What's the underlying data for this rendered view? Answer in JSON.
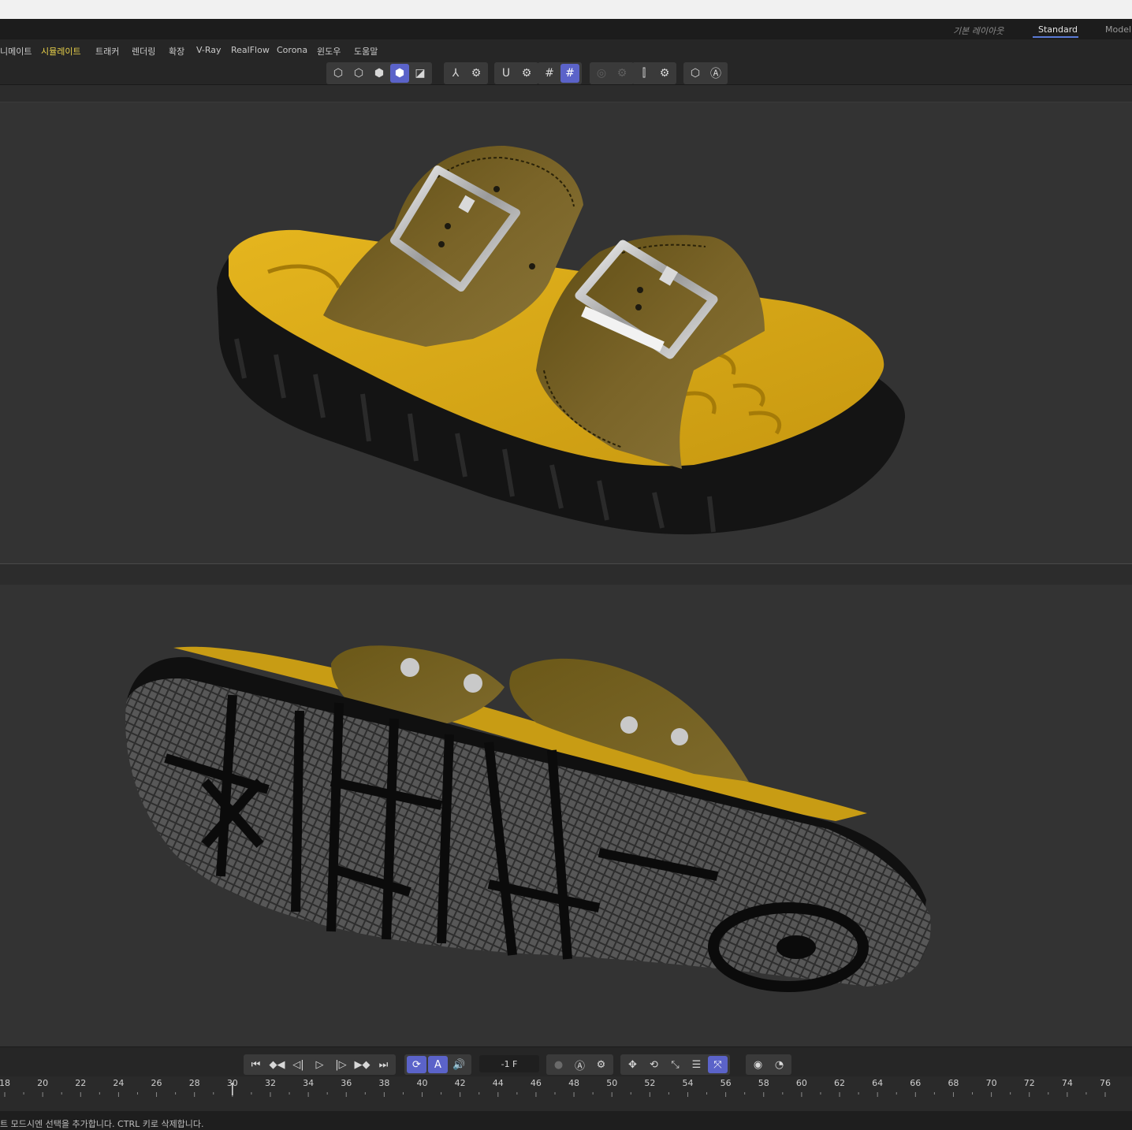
{
  "layouts": {
    "items": [
      {
        "label": "기본 레이아웃",
        "state": "italic"
      },
      {
        "label": "Standard",
        "state": "active"
      },
      {
        "label": "Model",
        "state": "normal"
      }
    ]
  },
  "menu": {
    "items": [
      {
        "label": "니메이트",
        "highlight": false
      },
      {
        "label": "시뮬레이트",
        "highlight": true
      },
      {
        "label": "트래커",
        "highlight": false
      },
      {
        "label": "렌더링",
        "highlight": false
      },
      {
        "label": "확장",
        "highlight": false
      },
      {
        "label": "V-Ray",
        "highlight": false
      },
      {
        "label": "RealFlow",
        "highlight": false
      },
      {
        "label": "Corona",
        "highlight": false
      },
      {
        "label": "윈도우",
        "highlight": false
      },
      {
        "label": "도움말",
        "highlight": false
      }
    ]
  },
  "toolbar": {
    "groups": [
      {
        "name": "mode-group",
        "buttons": [
          {
            "icon": "points-mode-icon",
            "glyph": "⬡",
            "active": false
          },
          {
            "icon": "edges-mode-icon",
            "glyph": "⬡",
            "active": false
          },
          {
            "icon": "polygons-mode-icon",
            "glyph": "⬢",
            "active": false
          },
          {
            "icon": "model-mode-icon",
            "glyph": "⬢",
            "active": true
          },
          {
            "icon": "texture-mode-icon",
            "glyph": "◪",
            "active": false
          }
        ]
      },
      {
        "name": "axis-group",
        "buttons": [
          {
            "icon": "axis-icon",
            "glyph": "⅄",
            "active": false
          },
          {
            "icon": "axis-settings-gear-icon",
            "glyph": "⚙",
            "active": false
          }
        ]
      },
      {
        "name": "snap-group",
        "buttons": [
          {
            "icon": "magnet-snap-icon",
            "glyph": "Ս",
            "active": false
          },
          {
            "icon": "snap-settings-gear-icon",
            "glyph": "⚙",
            "active": false
          }
        ]
      },
      {
        "name": "grid-group",
        "buttons": [
          {
            "icon": "grid-icon",
            "glyph": "#",
            "active": false
          },
          {
            "icon": "workplane-grid-icon",
            "glyph": "#",
            "active": true
          }
        ]
      },
      {
        "name": "softsel-group",
        "buttons": [
          {
            "icon": "soft-selection-icon",
            "glyph": "◎",
            "active": false,
            "dim": true
          },
          {
            "icon": "soft-selection-gear-icon",
            "glyph": "⚙",
            "active": false,
            "dim": true
          }
        ]
      },
      {
        "name": "symmetry-group",
        "buttons": [
          {
            "icon": "symmetry-icon",
            "glyph": "⫿",
            "active": false
          },
          {
            "icon": "symmetry-gear-icon",
            "glyph": "⚙",
            "active": false
          }
        ]
      },
      {
        "name": "render-group",
        "buttons": [
          {
            "icon": "viewport-solo-icon",
            "glyph": "⬡",
            "active": false
          },
          {
            "icon": "auto-keying-icon",
            "glyph": "Ⓐ",
            "active": false
          }
        ]
      }
    ]
  },
  "transport": {
    "frame_value": "-1 F",
    "groups": [
      {
        "name": "playback-group",
        "buttons": [
          {
            "icon": "go-to-start-icon",
            "glyph": "⏮",
            "active": false
          },
          {
            "icon": "previous-key-icon",
            "glyph": "◆◀",
            "active": false
          },
          {
            "icon": "previous-frame-icon",
            "glyph": "◁|",
            "active": false
          },
          {
            "icon": "play-icon",
            "glyph": "▷",
            "active": false
          },
          {
            "icon": "next-frame-icon",
            "glyph": "|▷",
            "active": false
          },
          {
            "icon": "next-key-icon",
            "glyph": "▶◆",
            "active": false
          },
          {
            "icon": "go-to-end-icon",
            "glyph": "⏭",
            "active": false
          }
        ]
      },
      {
        "name": "loop-group",
        "buttons": [
          {
            "icon": "loop-icon",
            "glyph": "⟳",
            "active": true
          },
          {
            "icon": "timeline-marker-icon",
            "glyph": "A",
            "active": true
          },
          {
            "icon": "sound-icon",
            "glyph": "🔊",
            "active": false
          }
        ]
      },
      {
        "name": "record-group",
        "buttons": [
          {
            "icon": "record-icon",
            "glyph": "●",
            "active": false,
            "dim": true
          },
          {
            "icon": "auto-key-icon",
            "glyph": "Ⓐ",
            "active": false
          },
          {
            "icon": "key-settings-icon",
            "glyph": "⚙",
            "active": false
          }
        ]
      },
      {
        "name": "key-group",
        "buttons": [
          {
            "icon": "move-key-icon",
            "glyph": "✥",
            "active": false
          },
          {
            "icon": "rotate-key-icon",
            "glyph": "⟲",
            "active": false
          },
          {
            "icon": "scale-key-icon",
            "glyph": "⤡",
            "active": false
          },
          {
            "icon": "param-key-icon",
            "glyph": "☰",
            "active": false
          },
          {
            "icon": "point-level-key-icon",
            "glyph": "⤧",
            "active": true
          }
        ]
      },
      {
        "name": "motion-group",
        "buttons": [
          {
            "icon": "motion-record-icon",
            "glyph": "◉",
            "active": false
          },
          {
            "icon": "motion-settings-icon",
            "glyph": "◔",
            "active": false
          }
        ]
      }
    ]
  },
  "timeline": {
    "current_frame": 30,
    "first_frame": 18,
    "last_frame": 76,
    "labels": [
      "18",
      "20",
      "22",
      "24",
      "26",
      "28",
      "30",
      "32",
      "34",
      "36",
      "38",
      "40",
      "42",
      "44",
      "46",
      "48",
      "50",
      "52",
      "54",
      "56",
      "58",
      "60",
      "62",
      "64",
      "66",
      "68",
      "70",
      "72",
      "74",
      "76"
    ]
  },
  "status": {
    "text": "트 모드시엔 선택을 추가합니다. CTRL 키로 삭제합니다."
  },
  "colors": {
    "accent": "#5b63c9",
    "menu_highlight": "#e7d04a",
    "viewport_bg": "#333333",
    "leather": "#6e5a20",
    "footbed": "#d5a718",
    "sole": "#141414"
  }
}
